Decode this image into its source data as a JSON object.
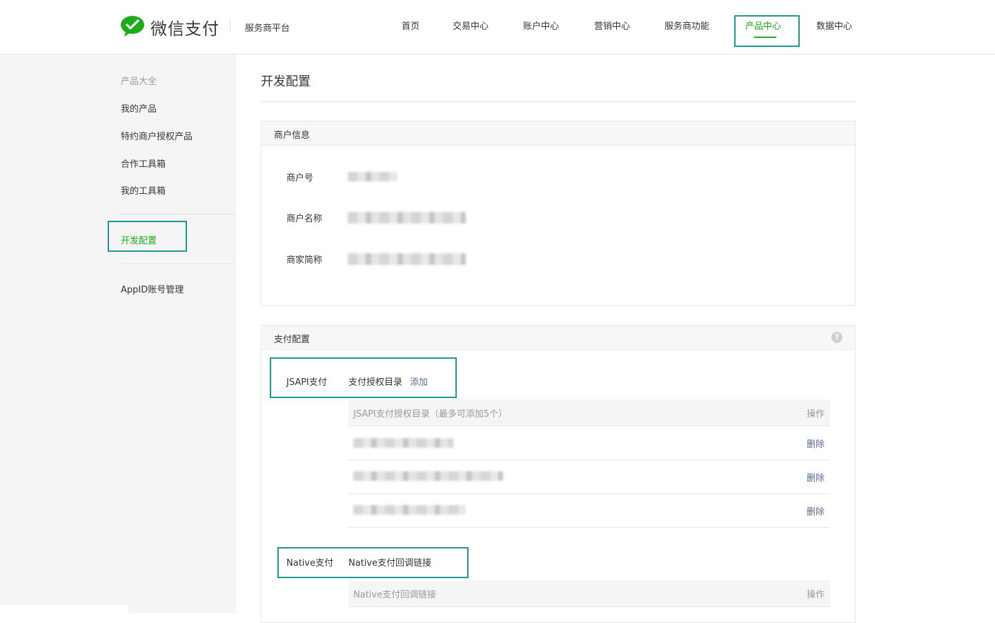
{
  "header": {
    "brand": "微信支付",
    "platform": "服务商平台",
    "nav": [
      {
        "label": "首页"
      },
      {
        "label": "交易中心"
      },
      {
        "label": "账户中心"
      },
      {
        "label": "营销中心"
      },
      {
        "label": "服务商功能"
      },
      {
        "label": "产品中心",
        "active": true
      },
      {
        "label": "数据中心"
      }
    ]
  },
  "sidebar": {
    "heading": "产品大全",
    "items": [
      {
        "label": "我的产品"
      },
      {
        "label": "特约商户授权产品"
      },
      {
        "label": "合作工具箱"
      },
      {
        "label": "我的工具箱"
      },
      {
        "label": "开发配置",
        "active": true
      },
      {
        "label": "AppID账号管理"
      }
    ]
  },
  "page": {
    "title": "开发配置"
  },
  "merchant_info": {
    "title": "商户信息",
    "fields": [
      {
        "label": "商户号"
      },
      {
        "label": "商户名称"
      },
      {
        "label": "商家简称"
      }
    ]
  },
  "pay_config": {
    "title": "支付配置",
    "help_glyph": "?",
    "jsapi": {
      "label": "JSAPI支付",
      "field": "支付授权目录",
      "add_link": "添加",
      "table_header": "JSAPI支付授权目录（最多可添加5个）",
      "action_header": "操作",
      "rows": [
        {
          "action": "删除"
        },
        {
          "action": "删除"
        },
        {
          "action": "删除"
        }
      ]
    },
    "native": {
      "label": "Native支付",
      "field": "Native支付回调链接",
      "table_header": "Native支付回调链接",
      "action_header": "操作"
    }
  },
  "colors": {
    "brand_green": "#1aad19",
    "highlight_box": "#1a9a8e",
    "link_blue": "#576b95"
  }
}
